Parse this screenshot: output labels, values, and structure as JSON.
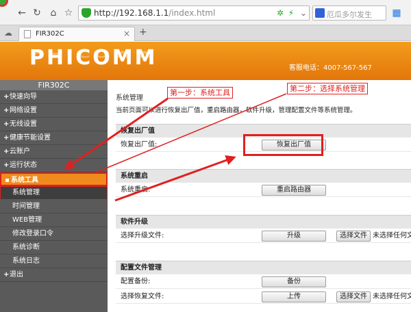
{
  "browser": {
    "url_host": "http://192.168.1.1",
    "url_path": "/index.html",
    "search_placeholder": "厄瓜多尔发生",
    "tab_title": "FIR302C",
    "tab_close": "×",
    "new_tab": "+"
  },
  "header": {
    "brand": "PHICOMM",
    "hotline": "客服电话：4007-567-567"
  },
  "sidebar": {
    "model": "FIR302C",
    "items": [
      {
        "label": "快速向导"
      },
      {
        "label": "网络设置"
      },
      {
        "label": "无线设置"
      },
      {
        "label": "健康节能设置"
      },
      {
        "label": "云账户"
      },
      {
        "label": "运行状态"
      },
      {
        "label": "系统工具"
      }
    ],
    "subitems": [
      {
        "label": "系统管理"
      },
      {
        "label": "时间管理"
      },
      {
        "label": "WEB管理"
      },
      {
        "label": "修改登录口令"
      },
      {
        "label": "系统诊断"
      },
      {
        "label": "系统日志"
      }
    ],
    "exit": "退出"
  },
  "main": {
    "title": "系统管理",
    "description": "当前页面可以进行恢复出厂值，重启路由器，软件升级，管理配置文件等系统管理。",
    "sections": [
      {
        "heading": "恢复出厂值",
        "label": "恢复出厂值:",
        "button": "恢复出厂值"
      },
      {
        "heading": "系统重启",
        "label": "系统重启:",
        "button": "重启路由器"
      },
      {
        "heading": "软件升级",
        "label": "选择升级文件:",
        "button": "升级",
        "file_button": "选择文件",
        "no_file": "未选择任何文件"
      },
      {
        "heading": "配置文件管理",
        "label": "配置备份:",
        "button": "备份",
        "label2": "选择恢复文件:",
        "button2": "上传",
        "file_button": "选择文件",
        "no_file": "未选择任何文件"
      }
    ]
  },
  "annotations": {
    "step1": "第一步：系统工具",
    "step2": "第二步：选择系统管理"
  },
  "colors": {
    "header_orange": "#f08a1c",
    "annotation_red": "#e02020",
    "sidebar_gray": "#5a5a5a"
  }
}
